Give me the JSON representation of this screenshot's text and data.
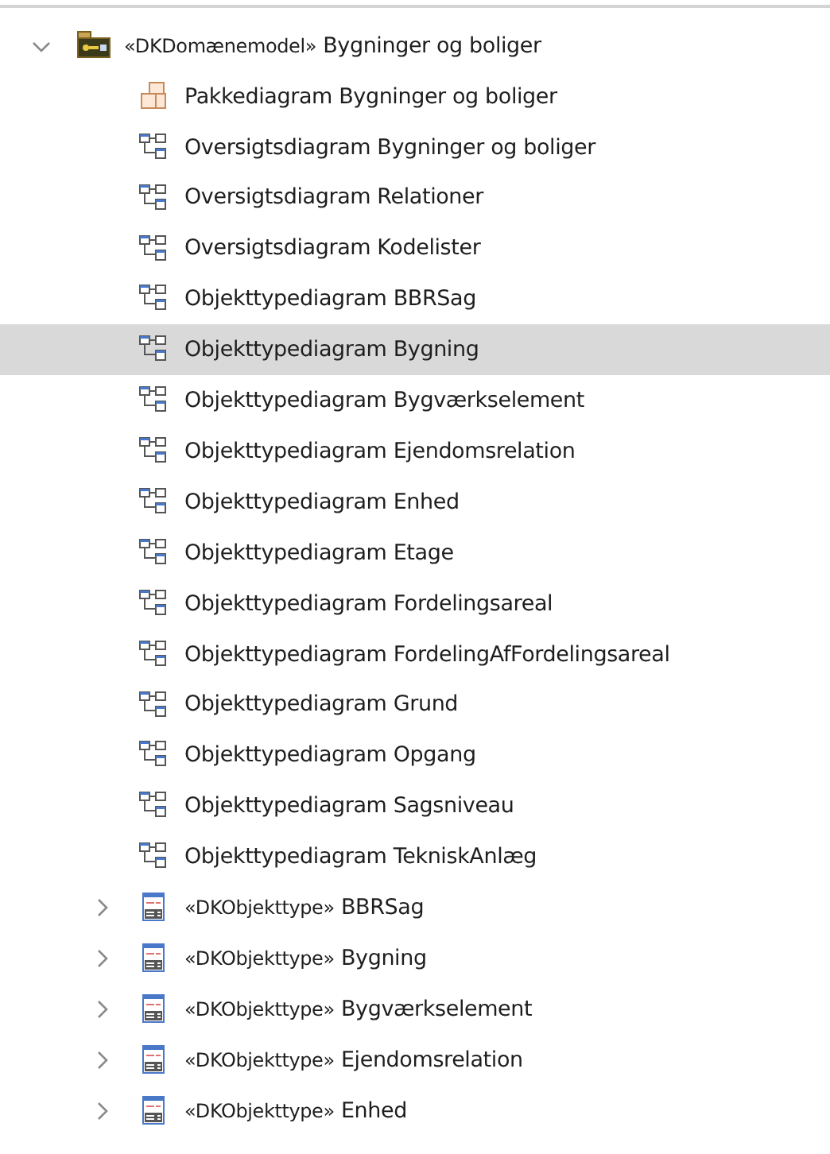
{
  "tree": [
    {
      "kind": "package",
      "stereotype": "«DKDomænemodel»",
      "name": "Bygninger og boliger",
      "expanded": true,
      "selected": false,
      "children": [
        {
          "kind": "package-diagram",
          "name": "Pakkediagram Bygninger og boliger",
          "selected": false
        },
        {
          "kind": "diagram",
          "name": "Oversigtsdiagram Bygninger og boliger",
          "selected": false
        },
        {
          "kind": "diagram",
          "name": "Oversigtsdiagram Relationer",
          "selected": false
        },
        {
          "kind": "diagram",
          "name": "Oversigtsdiagram Kodelister",
          "selected": false
        },
        {
          "kind": "diagram",
          "name": "Objekttypediagram BBRSag",
          "selected": false
        },
        {
          "kind": "diagram",
          "name": "Objekttypediagram Bygning",
          "selected": true
        },
        {
          "kind": "diagram",
          "name": "Objekttypediagram Bygværkselement",
          "selected": false
        },
        {
          "kind": "diagram",
          "name": "Objekttypediagram Ejendomsrelation",
          "selected": false
        },
        {
          "kind": "diagram",
          "name": "Objekttypediagram Enhed",
          "selected": false
        },
        {
          "kind": "diagram",
          "name": "Objekttypediagram Etage",
          "selected": false
        },
        {
          "kind": "diagram",
          "name": "Objekttypediagram Fordelingsareal",
          "selected": false
        },
        {
          "kind": "diagram",
          "name": "Objekttypediagram FordelingAfFordelingsareal",
          "selected": false
        },
        {
          "kind": "diagram",
          "name": "Objekttypediagram Grund",
          "selected": false
        },
        {
          "kind": "diagram",
          "name": "Objekttypediagram Opgang",
          "selected": false
        },
        {
          "kind": "diagram",
          "name": "Objekttypediagram Sagsniveau",
          "selected": false
        },
        {
          "kind": "diagram",
          "name": "Objekttypediagram TekniskAnlæg",
          "selected": false
        },
        {
          "kind": "class",
          "stereotype": "«DKObjekttype»",
          "name": "BBRSag",
          "expanded": false,
          "selected": false
        },
        {
          "kind": "class",
          "stereotype": "«DKObjekttype»",
          "name": "Bygning",
          "expanded": false,
          "selected": false
        },
        {
          "kind": "class",
          "stereotype": "«DKObjekttype»",
          "name": "Bygværkselement",
          "expanded": false,
          "selected": false
        },
        {
          "kind": "class",
          "stereotype": "«DKObjekttype»",
          "name": "Ejendomsrelation",
          "expanded": false,
          "selected": false
        },
        {
          "kind": "class",
          "stereotype": "«DKObjekttype»",
          "name": "Enhed",
          "expanded": false,
          "selected": false
        }
      ]
    }
  ]
}
